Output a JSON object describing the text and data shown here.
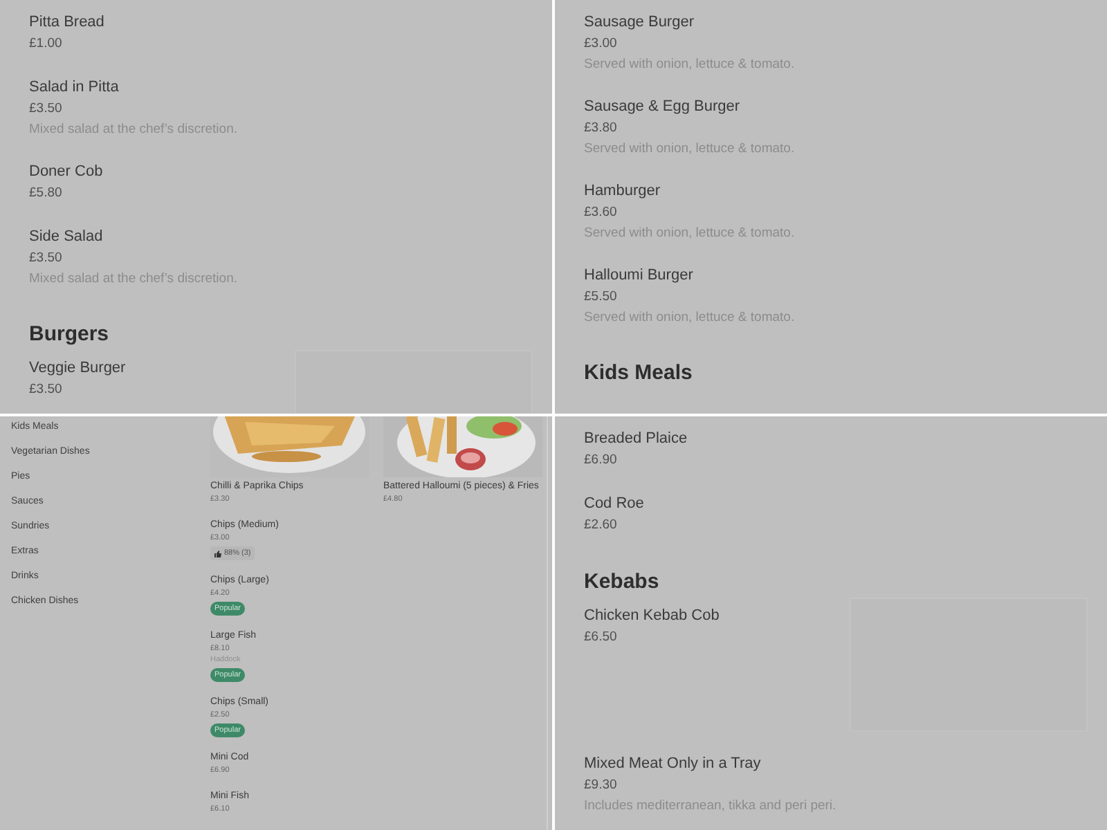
{
  "panels": [
    {
      "kind": "menu",
      "blocks": [
        {
          "kind": "item",
          "name": "Pitta Bread",
          "price": "£1.00",
          "image_placeholder": false
        },
        {
          "kind": "item",
          "name": "Salad in Pitta",
          "price": "£3.50",
          "description": "Mixed salad at the chef’s discretion.",
          "image_placeholder": false
        },
        {
          "kind": "item",
          "name": "Doner Cob",
          "price": "£5.80",
          "image_placeholder": false
        },
        {
          "kind": "item",
          "name": "Side Salad",
          "price": "£3.50",
          "description": "Mixed salad at the chef’s discretion.",
          "image_placeholder": false
        },
        {
          "kind": "heading",
          "title": "Burgers"
        },
        {
          "kind": "item",
          "name": "Veggie Burger",
          "price": "£3.50",
          "image_placeholder": true
        }
      ]
    },
    {
      "kind": "menu",
      "blocks": [
        {
          "kind": "item",
          "name": "Sausage Burger",
          "price": "£3.00",
          "description": "Served with onion, lettuce & tomato.",
          "image_placeholder": false
        },
        {
          "kind": "item",
          "name": "Sausage & Egg Burger",
          "price": "£3.80",
          "description": "Served with onion, lettuce & tomato.",
          "image_placeholder": false
        },
        {
          "kind": "item",
          "name": "Hamburger",
          "price": "£3.60",
          "description": "Served with onion, lettuce & tomato.",
          "image_placeholder": false
        },
        {
          "kind": "item",
          "name": "Halloumi Burger",
          "price": "£5.50",
          "description": "Served with onion, lettuce & tomato.",
          "image_placeholder": false
        },
        {
          "kind": "heading",
          "title": "Kids Meals"
        }
      ]
    },
    {
      "kind": "shop",
      "categories": [
        "Kids Meals",
        "Vegetarian Dishes",
        "Pies",
        "Sauces",
        "Sundries",
        "Extras",
        "Drinks",
        "Chicken Dishes"
      ],
      "featured": [
        {
          "name": "Chilli & Paprika Chips",
          "price": "£3.30"
        },
        {
          "name": "Battered Halloumi (5 pieces) & Fries",
          "price": "£4.80"
        }
      ],
      "items": [
        {
          "name": "Chips (Medium)",
          "price": "£3.00",
          "rating": "88% (3)"
        },
        {
          "name": "Chips (Large)",
          "price": "£4.20",
          "badge": "Popular"
        },
        {
          "name": "Large Fish",
          "price": "£8.10",
          "description": "Haddock",
          "badge": "Popular"
        },
        {
          "name": "Chips (Small)",
          "price": "£2.50",
          "badge": "Popular"
        },
        {
          "name": "Mini Cod",
          "price": "£6.90"
        },
        {
          "name": "Mini Fish",
          "price": "£6.10"
        }
      ]
    },
    {
      "kind": "menu",
      "blocks": [
        {
          "kind": "item",
          "name": "Breaded Plaice",
          "price": "£6.90",
          "image_placeholder": false
        },
        {
          "kind": "item",
          "name": "Cod Roe",
          "price": "£2.60",
          "image_placeholder": false
        },
        {
          "kind": "heading",
          "title": "Kebabs"
        },
        {
          "kind": "item",
          "name": "Chicken Kebab Cob",
          "price": "£6.50",
          "image_placeholder": true
        },
        {
          "kind": "item",
          "name": "Mixed Meat Only in a Tray",
          "price": "£9.30",
          "description": "Includes mediterranean, tikka and peri peri.",
          "image_placeholder": false
        }
      ]
    }
  ]
}
